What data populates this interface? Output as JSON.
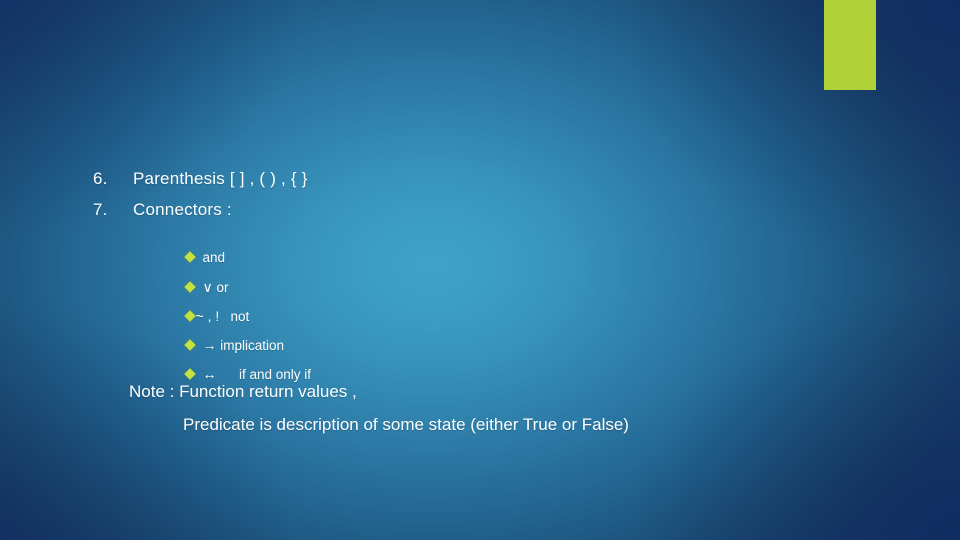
{
  "slide": {
    "accent_color": "#b0d238",
    "text_color": "#ffffff",
    "bullet_color": "#c3e243",
    "background_center_color": "#3fa2c6",
    "background_edge_color": "#193a72",
    "numbered_items": [
      {
        "marker": "6.",
        "text": "Parenthesis  [ ] , ( ) , { }"
      },
      {
        "marker": "7.",
        "text": "Connectors :"
      }
    ],
    "connector_bullets": [
      {
        "symbol": "",
        "label": "and"
      },
      {
        "symbol": "∨",
        "label": " or"
      },
      {
        "symbol": "~ , !",
        "label": "   not"
      },
      {
        "symbol": "→",
        "label": " implication"
      },
      {
        "symbol": "↔",
        "label": "      if and only if"
      }
    ],
    "note_lines": [
      "Note : Function return values ,",
      "Predicate is description of some state (either True or False)"
    ]
  }
}
